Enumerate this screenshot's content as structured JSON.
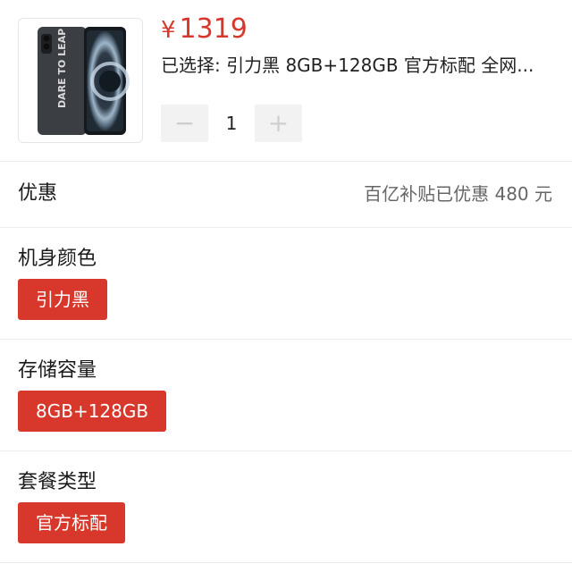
{
  "product": {
    "currency": "¥",
    "price": "1319",
    "selected_text": "已选择: 引力黑 8GB+128GB 官方标配 全网...",
    "quantity": "1",
    "minus_symbol": "−",
    "plus_symbol": "+",
    "phone_print": "DARE TO LEAP"
  },
  "discount": {
    "label": "优惠",
    "value": "百亿补贴已优惠 480 元"
  },
  "color_section": {
    "label": "机身颜色",
    "option": "引力黑"
  },
  "storage_section": {
    "label": "存储容量",
    "option": "8GB+128GB"
  },
  "package_section": {
    "label": "套餐类型",
    "option": "官方标配"
  },
  "colors": {
    "accent": "#d8382c",
    "divider": "#ececec",
    "stepper_bg": "#f2f2f2"
  }
}
